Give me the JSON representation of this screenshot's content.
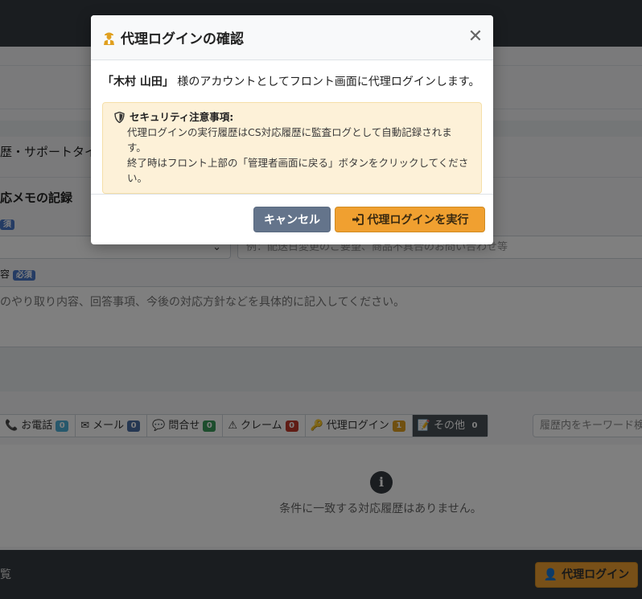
{
  "background": {
    "section_partial": "歴・サポートタイム",
    "memo_heading": "応メモの記録",
    "required_badge_1": "須",
    "memo_label_partial": "容",
    "required_badge_2": "必須",
    "subject_placeholder": "例：配送日変更のご要望、商品不具合のお問い合わせ等",
    "memo_placeholder": "のやり取り内容、回答事項、今後の対応方針などを具体的に記入してください。",
    "tabs": [
      {
        "icon": "phone-icon",
        "label": "お電話",
        "count": "0",
        "color": "#4fb0d8"
      },
      {
        "icon": "mail-icon",
        "label": "メール",
        "count": "0",
        "color": "#4a6fa5"
      },
      {
        "icon": "chat-icon",
        "label": "問合せ",
        "count": "0",
        "color": "#3a9a5a"
      },
      {
        "icon": "warning-icon",
        "label": "クレーム",
        "count": "0",
        "color": "#c0392b"
      },
      {
        "icon": "key-icon",
        "label": "代理ログイン",
        "count": "1",
        "color": "#e0a020"
      },
      {
        "icon": "note-icon",
        "label": "その他",
        "count": "0",
        "color": "#495057"
      }
    ],
    "keyword_placeholder": "履歴内をキーワード検索",
    "empty_message": "条件に一致する対応履歴はありません。",
    "footer_left": "覧",
    "footer_button": "代理ログイン"
  },
  "modal": {
    "title": "代理ログインの確認",
    "name": "「木村 山田」",
    "message": " 様のアカウントとしてフロント画面に代理ログインします。",
    "alert_title": "セキュリティ注意事項:",
    "alert_line1": "代理ログインの実行履歴はCS対応履歴に監査ログとして自動記録されます。",
    "alert_line2": "終了時はフロント上部の「管理者画面に戻る」ボタンをクリックしてください。",
    "cancel_label": "キャンセル",
    "execute_label": "代理ログインを実行"
  }
}
